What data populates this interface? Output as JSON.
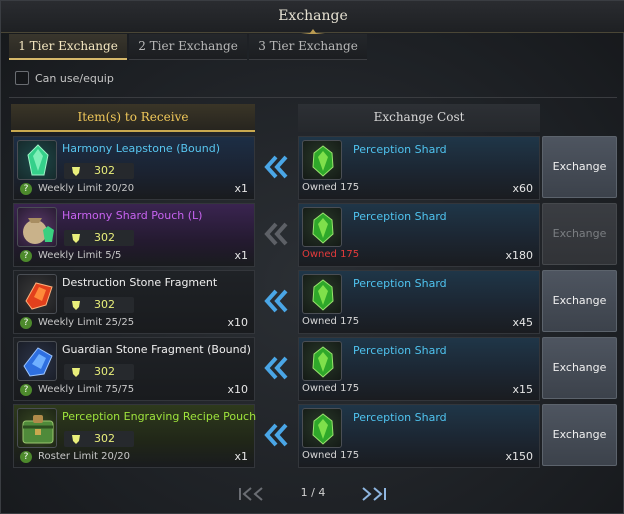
{
  "window": {
    "title": "Exchange"
  },
  "tabs": [
    {
      "label": "1 Tier Exchange",
      "active": true
    },
    {
      "label": "2 Tier Exchange",
      "active": false
    },
    {
      "label": "3 Tier Exchange",
      "active": false
    }
  ],
  "filter": {
    "label": "Can use/equip",
    "checked": false
  },
  "columns": {
    "receive": "Item(s) to Receive",
    "cost": "Exchange Cost"
  },
  "rows": [
    {
      "item_name": "Harmony Leapstone (Bound)",
      "item_color": "#58c6f0",
      "price": "302",
      "limit": "Weekly Limit 20/20",
      "quantity": "x1",
      "cost_name": "Perception Shard",
      "owned": "Owned 175",
      "owned_short": false,
      "cost_qty": "x60",
      "button": "Exchange",
      "enabled": true,
      "icon": "leapstone-icon"
    },
    {
      "item_name": "Harmony Shard Pouch (L)",
      "item_color": "#c763f0",
      "price": "302",
      "limit": "Weekly Limit 5/5",
      "quantity": "x1",
      "cost_name": "Perception Shard",
      "owned": "Owned 175",
      "owned_short": true,
      "cost_qty": "x180",
      "button": "Exchange",
      "enabled": false,
      "icon": "shard-pouch-icon"
    },
    {
      "item_name": "Destruction Stone Fragment",
      "item_color": "#f0f0f0",
      "price": "302",
      "limit": "Weekly Limit 25/25",
      "quantity": "x10",
      "cost_name": "Perception Shard",
      "owned": "Owned 175",
      "owned_short": false,
      "cost_qty": "x45",
      "button": "Exchange",
      "enabled": true,
      "icon": "destruction-stone-icon"
    },
    {
      "item_name": "Guardian Stone Fragment (Bound)",
      "item_color": "#f0f0f0",
      "price": "302",
      "limit": "Weekly Limit 75/75",
      "quantity": "x10",
      "cost_name": "Perception Shard",
      "owned": "Owned 175",
      "owned_short": false,
      "cost_qty": "x15",
      "button": "Exchange",
      "enabled": true,
      "icon": "guardian-stone-icon"
    },
    {
      "item_name": "Perception Engraving Recipe Pouch",
      "item_color": "#9fe43c",
      "price": "302",
      "limit": "Roster Limit 20/20",
      "quantity": "x1",
      "cost_name": "Perception Shard",
      "owned": "Owned 175",
      "owned_short": false,
      "cost_qty": "x150",
      "button": "Exchange",
      "enabled": true,
      "icon": "recipe-pouch-icon"
    }
  ],
  "pager": {
    "text": "1 / 4"
  },
  "colors": {
    "gold": "#f0c85a",
    "cost_name": "#4fc3ef",
    "price": "#e9ef7b",
    "warning": "#e33b3b"
  }
}
